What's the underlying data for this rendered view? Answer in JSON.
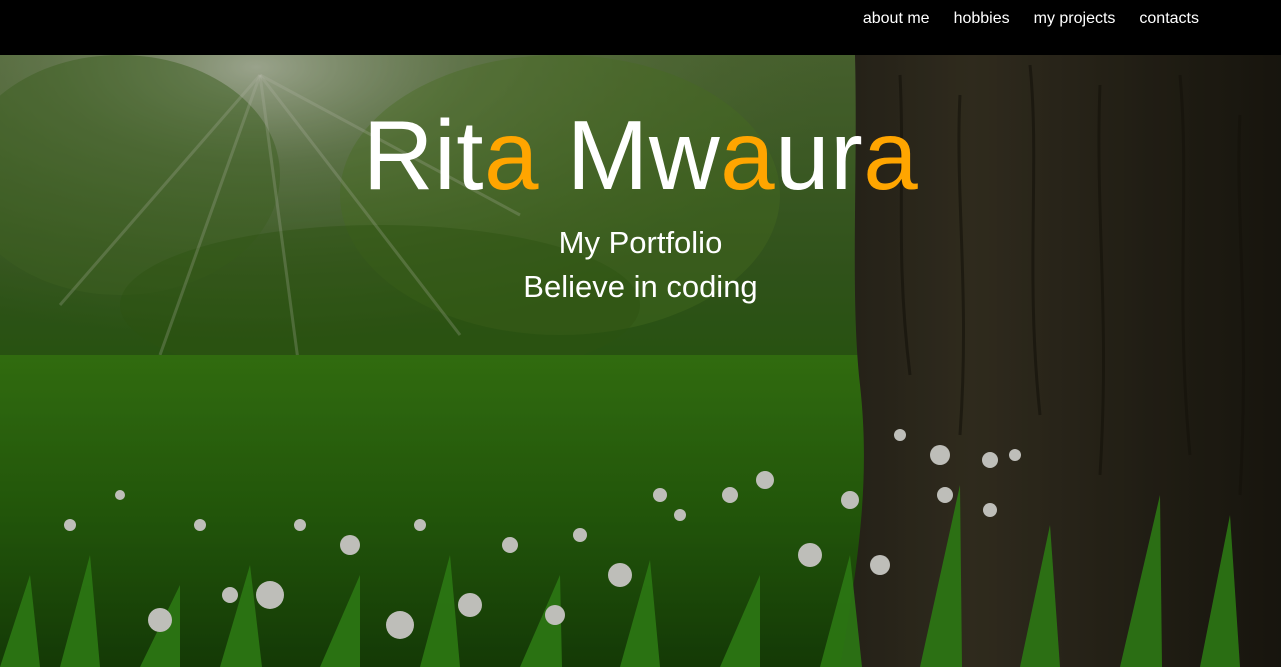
{
  "nav": {
    "items": [
      "about me",
      "hobbies",
      "my projects",
      "contacts"
    ]
  },
  "hero": {
    "name_parts": [
      {
        "text": "Rit",
        "accent": false
      },
      {
        "text": "a",
        "accent": true
      },
      {
        "text": " Mw",
        "accent": false
      },
      {
        "text": "a",
        "accent": true
      },
      {
        "text": "ur",
        "accent": false
      },
      {
        "text": "a",
        "accent": true
      }
    ],
    "subtitle": "My Portfolio",
    "tagline": "Believe in coding"
  },
  "colors": {
    "accent": "#FFA500",
    "navbar": "#000000",
    "text": "#FFFFFF"
  }
}
